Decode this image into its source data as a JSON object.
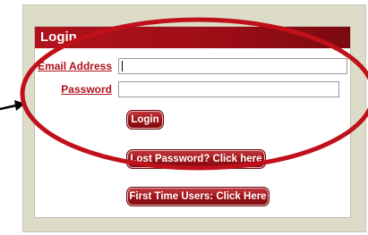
{
  "login": {
    "title": "Login",
    "email_label": "Email Address",
    "email_value": "",
    "password_label": "Password",
    "password_value": "",
    "login_button": "Login",
    "lost_password_button": "Lost Password? Click here",
    "first_time_button": "First Time Users: Click Here"
  },
  "annotation": {
    "highlight_color": "#c0101a",
    "arrow_icon": "arrow-right-icon"
  }
}
